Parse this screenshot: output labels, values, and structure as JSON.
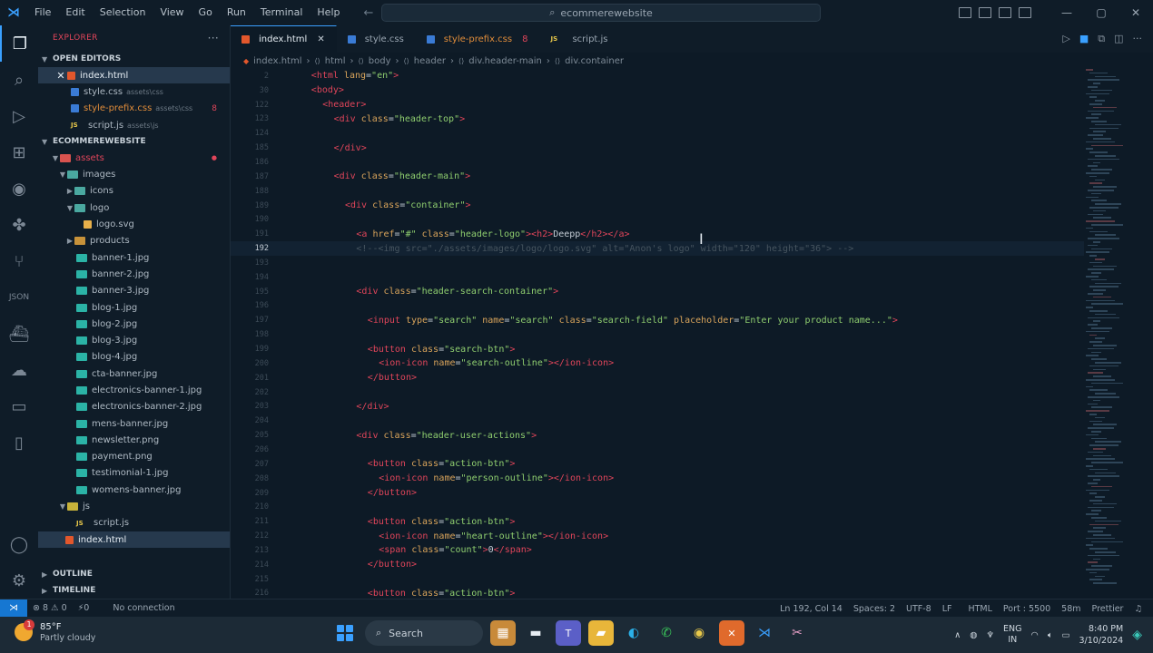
{
  "titlebar": {
    "menu": [
      "File",
      "Edit",
      "Selection",
      "View",
      "Go",
      "Run",
      "Terminal",
      "Help"
    ],
    "search_text": "ecommerewebsite",
    "colors": {
      "accent": "#3aa0ff"
    }
  },
  "sidebar": {
    "title": "EXPLORER",
    "more": "···",
    "open_editors_label": "OPEN EDITORS",
    "open_editors": [
      {
        "name": "index.html",
        "path": "",
        "icon": "html"
      },
      {
        "name": "style.css",
        "path": "assets\\css",
        "icon": "css"
      },
      {
        "name": "style-prefix.css",
        "path": "assets\\css",
        "icon": "css",
        "badge": "8"
      },
      {
        "name": "script.js",
        "path": "assets\\js",
        "icon": "js"
      }
    ],
    "project_label": "ECOMMEREWEBSITE",
    "tree": {
      "assets": "assets",
      "images": "images",
      "icons": "icons",
      "logo": "logo",
      "logo_svg": "logo.svg",
      "products": "products",
      "files": [
        "banner-1.jpg",
        "banner-2.jpg",
        "banner-3.jpg",
        "blog-1.jpg",
        "blog-2.jpg",
        "blog-3.jpg",
        "blog-4.jpg",
        "cta-banner.jpg",
        "electronics-banner-1.jpg",
        "electronics-banner-2.jpg",
        "mens-banner.jpg",
        "newsletter.png",
        "payment.png",
        "testimonial-1.jpg",
        "womens-banner.jpg"
      ],
      "js": "js",
      "script_js": "script.js",
      "index_html": "index.html"
    },
    "outline_label": "OUTLINE",
    "timeline_label": "TIMELINE"
  },
  "tabs": [
    {
      "label": "index.html",
      "icon": "html",
      "active": true
    },
    {
      "label": "style.css",
      "icon": "css"
    },
    {
      "label": "style-prefix.css",
      "icon": "css",
      "count": "8"
    },
    {
      "label": "script.js",
      "icon": "js"
    }
  ],
  "breadcrumb": [
    "index.html",
    "html",
    "body",
    "header",
    "div.header-main",
    "div.container"
  ],
  "code_lines": [
    {
      "n": "2",
      "indent": 4,
      "parts": [
        [
          "tag",
          "<html "
        ],
        [
          "attr",
          "lang"
        ],
        [
          "plain",
          "="
        ],
        [
          "str",
          "\"en\""
        ],
        [
          "tag",
          ">"
        ]
      ]
    },
    {
      "n": "30",
      "indent": 4,
      "parts": [
        [
          "tag",
          "<body>"
        ]
      ]
    },
    {
      "n": "122",
      "indent": 6,
      "parts": [
        [
          "tag",
          "<header>"
        ]
      ]
    },
    {
      "n": "123",
      "indent": 8,
      "parts": [
        [
          "tag",
          "<div "
        ],
        [
          "attr",
          "class"
        ],
        [
          "plain",
          "="
        ],
        [
          "str",
          "\"header-top\""
        ],
        [
          "tag",
          ">"
        ]
      ]
    },
    {
      "n": "124",
      "indent": 0,
      "parts": []
    },
    {
      "n": "185",
      "indent": 8,
      "parts": [
        [
          "tag",
          "</div>"
        ]
      ]
    },
    {
      "n": "186",
      "indent": 0,
      "parts": []
    },
    {
      "n": "187",
      "indent": 8,
      "parts": [
        [
          "tag",
          "<div "
        ],
        [
          "attr",
          "class"
        ],
        [
          "plain",
          "="
        ],
        [
          "str",
          "\"header-main\""
        ],
        [
          "tag",
          ">"
        ]
      ]
    },
    {
      "n": "188",
      "indent": 0,
      "parts": []
    },
    {
      "n": "189",
      "indent": 10,
      "parts": [
        [
          "tag",
          "<div "
        ],
        [
          "attr",
          "class"
        ],
        [
          "plain",
          "="
        ],
        [
          "str",
          "\"container\""
        ],
        [
          "tag",
          ">"
        ]
      ]
    },
    {
      "n": "190",
      "indent": 0,
      "parts": []
    },
    {
      "n": "191",
      "indent": 12,
      "parts": [
        [
          "tag",
          "<a "
        ],
        [
          "attr",
          "href"
        ],
        [
          "plain",
          "="
        ],
        [
          "str",
          "\"#\""
        ],
        [
          "attr",
          " class"
        ],
        [
          "plain",
          "="
        ],
        [
          "str",
          "\"header-logo\""
        ],
        [
          "tag",
          "><h2>"
        ],
        [
          "plain",
          "Deepp"
        ],
        [
          "tag",
          "</h2></a>"
        ]
      ]
    },
    {
      "n": "192",
      "indent": 12,
      "current": true,
      "parts": [
        [
          "comment",
          "<!--<img src=\"./assets/images/logo/logo.svg\" alt=\"Anon's logo\" width=\"120\" height=\"36\"> -->"
        ]
      ]
    },
    {
      "n": "193",
      "indent": 0,
      "parts": []
    },
    {
      "n": "194",
      "indent": 0,
      "parts": []
    },
    {
      "n": "195",
      "indent": 12,
      "parts": [
        [
          "tag",
          "<div "
        ],
        [
          "attr",
          "class"
        ],
        [
          "plain",
          "="
        ],
        [
          "str",
          "\"header-search-container\""
        ],
        [
          "tag",
          ">"
        ]
      ]
    },
    {
      "n": "196",
      "indent": 0,
      "parts": []
    },
    {
      "n": "197",
      "indent": 14,
      "parts": [
        [
          "tag",
          "<input "
        ],
        [
          "attr",
          "type"
        ],
        [
          "plain",
          "="
        ],
        [
          "str",
          "\"search\""
        ],
        [
          "attr",
          " name"
        ],
        [
          "plain",
          "="
        ],
        [
          "str",
          "\"search\""
        ],
        [
          "attr",
          " class"
        ],
        [
          "plain",
          "="
        ],
        [
          "str",
          "\"search-field\""
        ],
        [
          "attr",
          " placeholder"
        ],
        [
          "plain",
          "="
        ],
        [
          "str",
          "\"Enter your product name...\""
        ],
        [
          "tag",
          ">"
        ]
      ]
    },
    {
      "n": "198",
      "indent": 0,
      "parts": []
    },
    {
      "n": "199",
      "indent": 14,
      "parts": [
        [
          "tag",
          "<button "
        ],
        [
          "attr",
          "class"
        ],
        [
          "plain",
          "="
        ],
        [
          "str",
          "\"search-btn\""
        ],
        [
          "tag",
          ">"
        ]
      ]
    },
    {
      "n": "200",
      "indent": 16,
      "parts": [
        [
          "tag",
          "<ion-icon "
        ],
        [
          "attr",
          "name"
        ],
        [
          "plain",
          "="
        ],
        [
          "str",
          "\"search-outline\""
        ],
        [
          "tag",
          "></ion-icon>"
        ]
      ]
    },
    {
      "n": "201",
      "indent": 14,
      "parts": [
        [
          "tag",
          "</button>"
        ]
      ]
    },
    {
      "n": "202",
      "indent": 0,
      "parts": []
    },
    {
      "n": "203",
      "indent": 12,
      "parts": [
        [
          "tag",
          "</div>"
        ]
      ]
    },
    {
      "n": "204",
      "indent": 0,
      "parts": []
    },
    {
      "n": "205",
      "indent": 12,
      "parts": [
        [
          "tag",
          "<div "
        ],
        [
          "attr",
          "class"
        ],
        [
          "plain",
          "="
        ],
        [
          "str",
          "\"header-user-actions\""
        ],
        [
          "tag",
          ">"
        ]
      ]
    },
    {
      "n": "206",
      "indent": 0,
      "parts": []
    },
    {
      "n": "207",
      "indent": 14,
      "parts": [
        [
          "tag",
          "<button "
        ],
        [
          "attr",
          "class"
        ],
        [
          "plain",
          "="
        ],
        [
          "str",
          "\"action-btn\""
        ],
        [
          "tag",
          ">"
        ]
      ]
    },
    {
      "n": "208",
      "indent": 16,
      "parts": [
        [
          "tag",
          "<ion-icon "
        ],
        [
          "attr",
          "name"
        ],
        [
          "plain",
          "="
        ],
        [
          "str",
          "\"person-outline\""
        ],
        [
          "tag",
          "></ion-icon>"
        ]
      ]
    },
    {
      "n": "209",
      "indent": 14,
      "parts": [
        [
          "tag",
          "</button>"
        ]
      ]
    },
    {
      "n": "210",
      "indent": 0,
      "parts": []
    },
    {
      "n": "211",
      "indent": 14,
      "parts": [
        [
          "tag",
          "<button "
        ],
        [
          "attr",
          "class"
        ],
        [
          "plain",
          "="
        ],
        [
          "str",
          "\"action-btn\""
        ],
        [
          "tag",
          ">"
        ]
      ]
    },
    {
      "n": "212",
      "indent": 16,
      "parts": [
        [
          "tag",
          "<ion-icon "
        ],
        [
          "attr",
          "name"
        ],
        [
          "plain",
          "="
        ],
        [
          "str",
          "\"heart-outline\""
        ],
        [
          "tag",
          "></ion-icon>"
        ]
      ]
    },
    {
      "n": "213",
      "indent": 16,
      "parts": [
        [
          "tag",
          "<span "
        ],
        [
          "attr",
          "class"
        ],
        [
          "plain",
          "="
        ],
        [
          "str",
          "\"count\""
        ],
        [
          "tag",
          ">"
        ],
        [
          "plain",
          "0"
        ],
        [
          "tag",
          "</span>"
        ]
      ]
    },
    {
      "n": "214",
      "indent": 14,
      "parts": [
        [
          "tag",
          "</button>"
        ]
      ]
    },
    {
      "n": "215",
      "indent": 0,
      "parts": []
    },
    {
      "n": "216",
      "indent": 14,
      "parts": [
        [
          "tag",
          "<button "
        ],
        [
          "attr",
          "class"
        ],
        [
          "plain",
          "="
        ],
        [
          "str",
          "\"action-btn\""
        ],
        [
          "tag",
          ">"
        ]
      ]
    }
  ],
  "statusbar": {
    "problems": "⊗ 8 ⚠ 0",
    "ports": "⚡0",
    "connection": "No connection",
    "position": "Ln 192, Col 14",
    "spaces": "Spaces: 2",
    "encoding": "UTF-8",
    "eol": "LF",
    "language": "HTML",
    "port": "Port : 5500",
    "timer": "58m",
    "prettier": "Prettier"
  },
  "taskbar": {
    "temp": "85°F",
    "weather": "Partly cloudy",
    "weather_alert": "1",
    "search": "Search",
    "lang1": "ENG",
    "lang2": "IN",
    "time": "8:40 PM",
    "date": "3/10/2024"
  }
}
